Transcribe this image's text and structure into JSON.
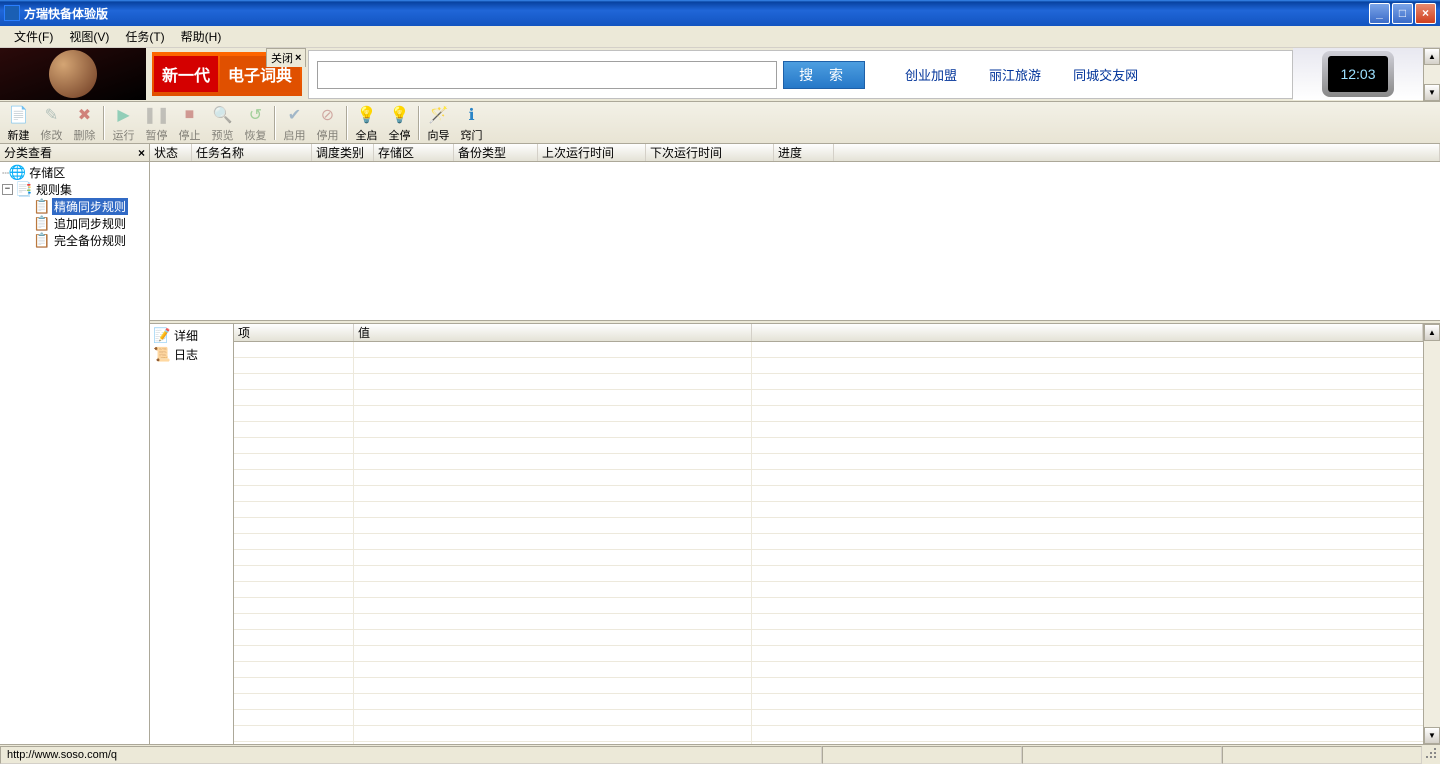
{
  "title": "方瑞快备体验版",
  "menu": {
    "file": "文件(F)",
    "view": "视图(V)",
    "task": "任务(T)",
    "help": "帮助(H)"
  },
  "ad": {
    "close": "关闭",
    "dict_new": "新一代",
    "dict_text": "电子词典",
    "search_btn": "搜 索",
    "links": [
      "创业加盟",
      "丽江旅游",
      "同城交友网"
    ],
    "phone_time": "12:03"
  },
  "toolbar": {
    "new": "新建",
    "edit": "修改",
    "del": "删除",
    "run": "运行",
    "pause": "暂停",
    "stop": "停止",
    "preview": "预览",
    "recover": "恢复",
    "enable": "启用",
    "disable": "停用",
    "allstart": "全启",
    "allstop": "全停",
    "wizard": "向导",
    "tips": "窍门"
  },
  "sidebar": {
    "title": "分类查看",
    "storage": "存储区",
    "ruleset": "规则集",
    "rules": [
      "精确同步规则",
      "追加同步规则",
      "完全备份规则"
    ]
  },
  "task_cols": [
    "状态",
    "任务名称",
    "调度类别",
    "存储区",
    "备份类型",
    "上次运行时间",
    "下次运行时间",
    "进度"
  ],
  "detail": {
    "tabs": [
      "详细",
      "日志"
    ],
    "cols": [
      "项",
      "值"
    ]
  },
  "status": {
    "url": "http://www.soso.com/q"
  }
}
